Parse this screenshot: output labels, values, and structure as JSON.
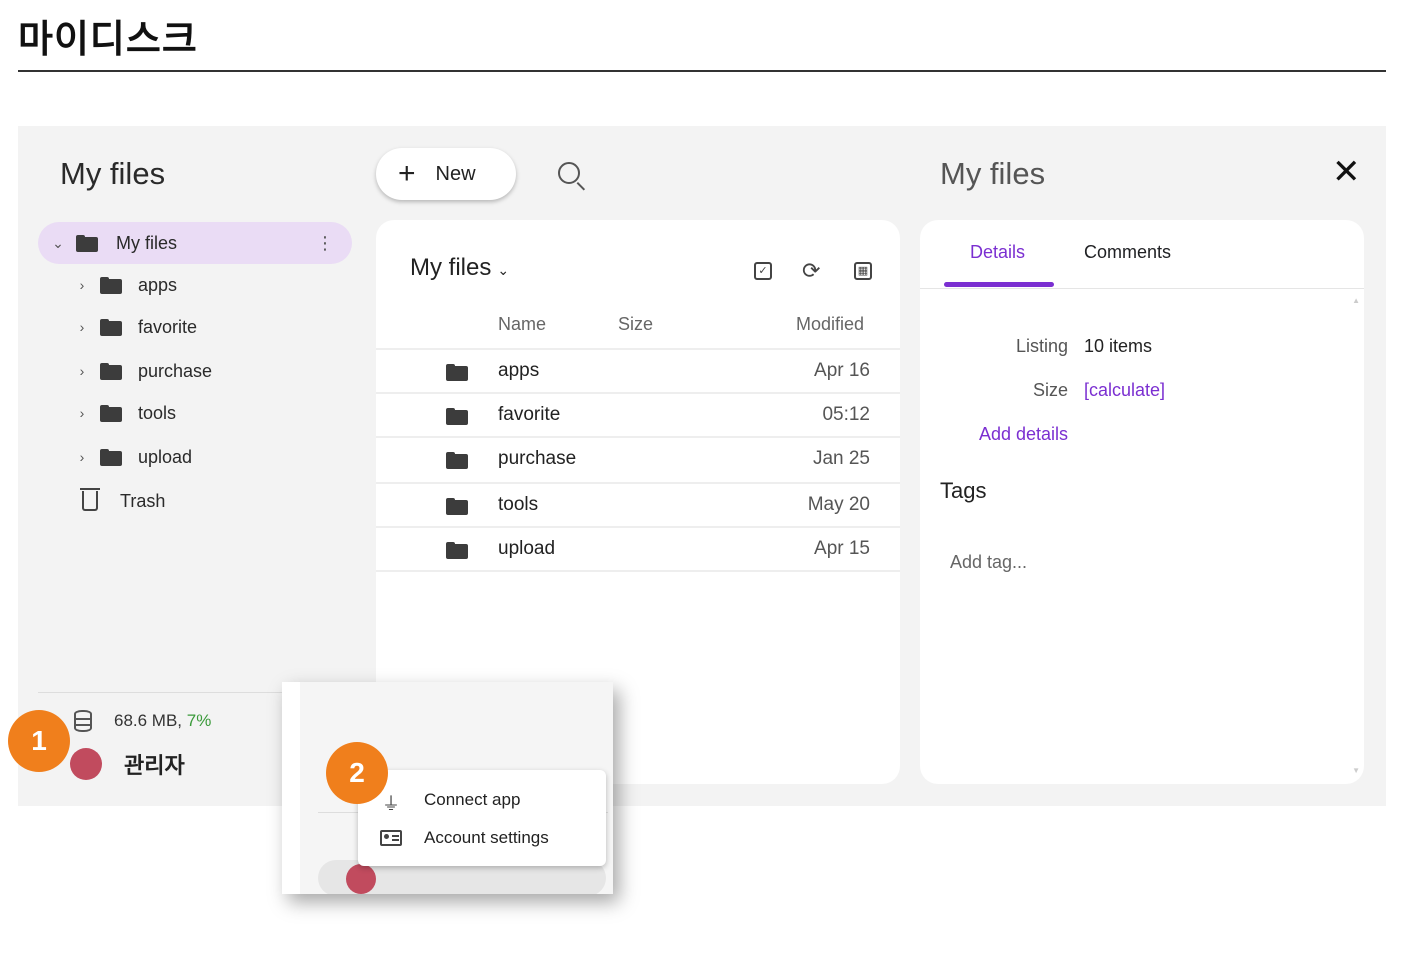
{
  "doc_title": "마이디스크",
  "sidebar": {
    "title": "My files",
    "active_item": "My files",
    "items": [
      {
        "label": "apps"
      },
      {
        "label": "favorite"
      },
      {
        "label": "purchase"
      },
      {
        "label": "tools"
      },
      {
        "label": "upload"
      }
    ],
    "trash_label": "Trash",
    "storage_used": "68.6 MB,",
    "storage_pct": "7%",
    "user_name": "관리자"
  },
  "toolbar": {
    "new_label": "New"
  },
  "files": {
    "title": "My files",
    "columns": {
      "name": "Name",
      "size": "Size",
      "modified": "Modified"
    },
    "rows": [
      {
        "name": "apps",
        "modified": "Apr 16"
      },
      {
        "name": "favorite",
        "modified": "05:12"
      },
      {
        "name": "purchase",
        "modified": "Jan 25"
      },
      {
        "name": "tools",
        "modified": "May 20"
      },
      {
        "name": "upload",
        "modified": "Apr 15"
      }
    ]
  },
  "details": {
    "title": "My files",
    "tabs": [
      "Details",
      "Comments"
    ],
    "listing_label": "Listing",
    "listing_value": "10 items",
    "size_label": "Size",
    "size_value": "[calculate]",
    "add_details": "Add details",
    "tags_label": "Tags",
    "add_tag_placeholder": "Add tag..."
  },
  "popup_menu": {
    "items": [
      "Connect app",
      "Account settings"
    ]
  },
  "badges": [
    "1",
    "2"
  ],
  "colors": {
    "accent": "#7b2fd1",
    "badge": "#f07f1c",
    "avatar": "#c14b5e",
    "active_bg": "#eadcf5"
  }
}
